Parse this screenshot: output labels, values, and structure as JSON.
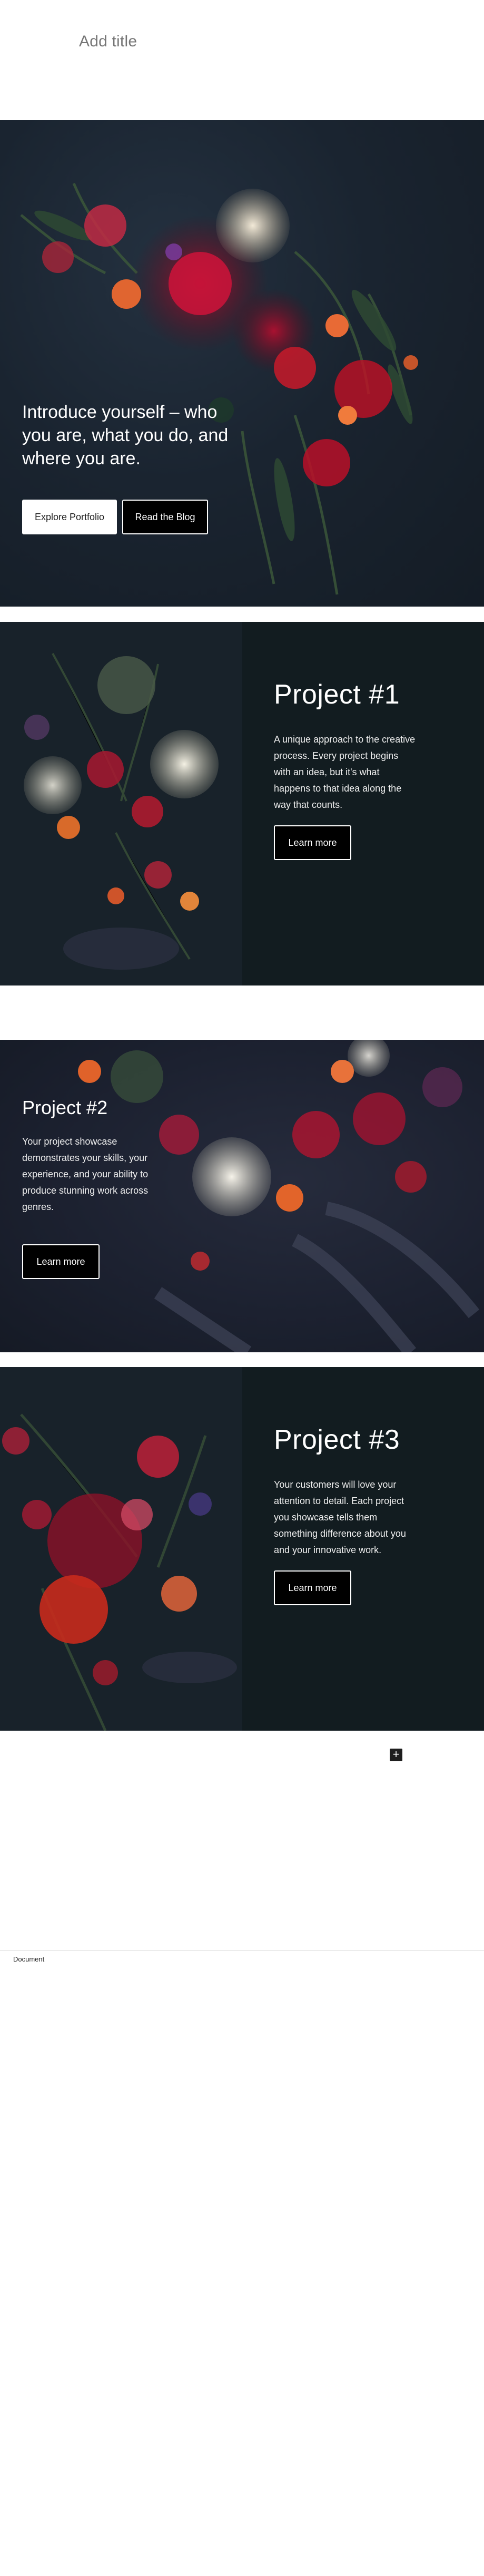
{
  "editor": {
    "title_placeholder": "Add title",
    "breadcrumb": "Document",
    "inserter_symbol": "+"
  },
  "hero": {
    "heading": "Introduce yourself – who you are, what you do, and where you are.",
    "primary_button": "Explore Portfolio",
    "secondary_button": "Read the Blog"
  },
  "projects": [
    {
      "heading": "Project #1",
      "text": "A unique approach to the creative process. Every project begins with an idea, but it's what happens to that idea along the way that counts.",
      "button": "Learn more"
    },
    {
      "heading": "Project #2",
      "text": "Your project showcase demonstrates your skills, your experience, and your ability to produce stunning work across genres.",
      "button": "Learn more"
    },
    {
      "heading": "Project #3",
      "text": "Your customers will love your attention to detail. Each project you showcase tells them something difference about you and your innovative work.",
      "button": "Learn more"
    }
  ],
  "colors": {
    "cover_dark": "#1a2430",
    "panel_dark": "#121c20",
    "button_black": "#000000",
    "button_white": "#ffffff"
  },
  "icons": [
    "plus-icon"
  ]
}
